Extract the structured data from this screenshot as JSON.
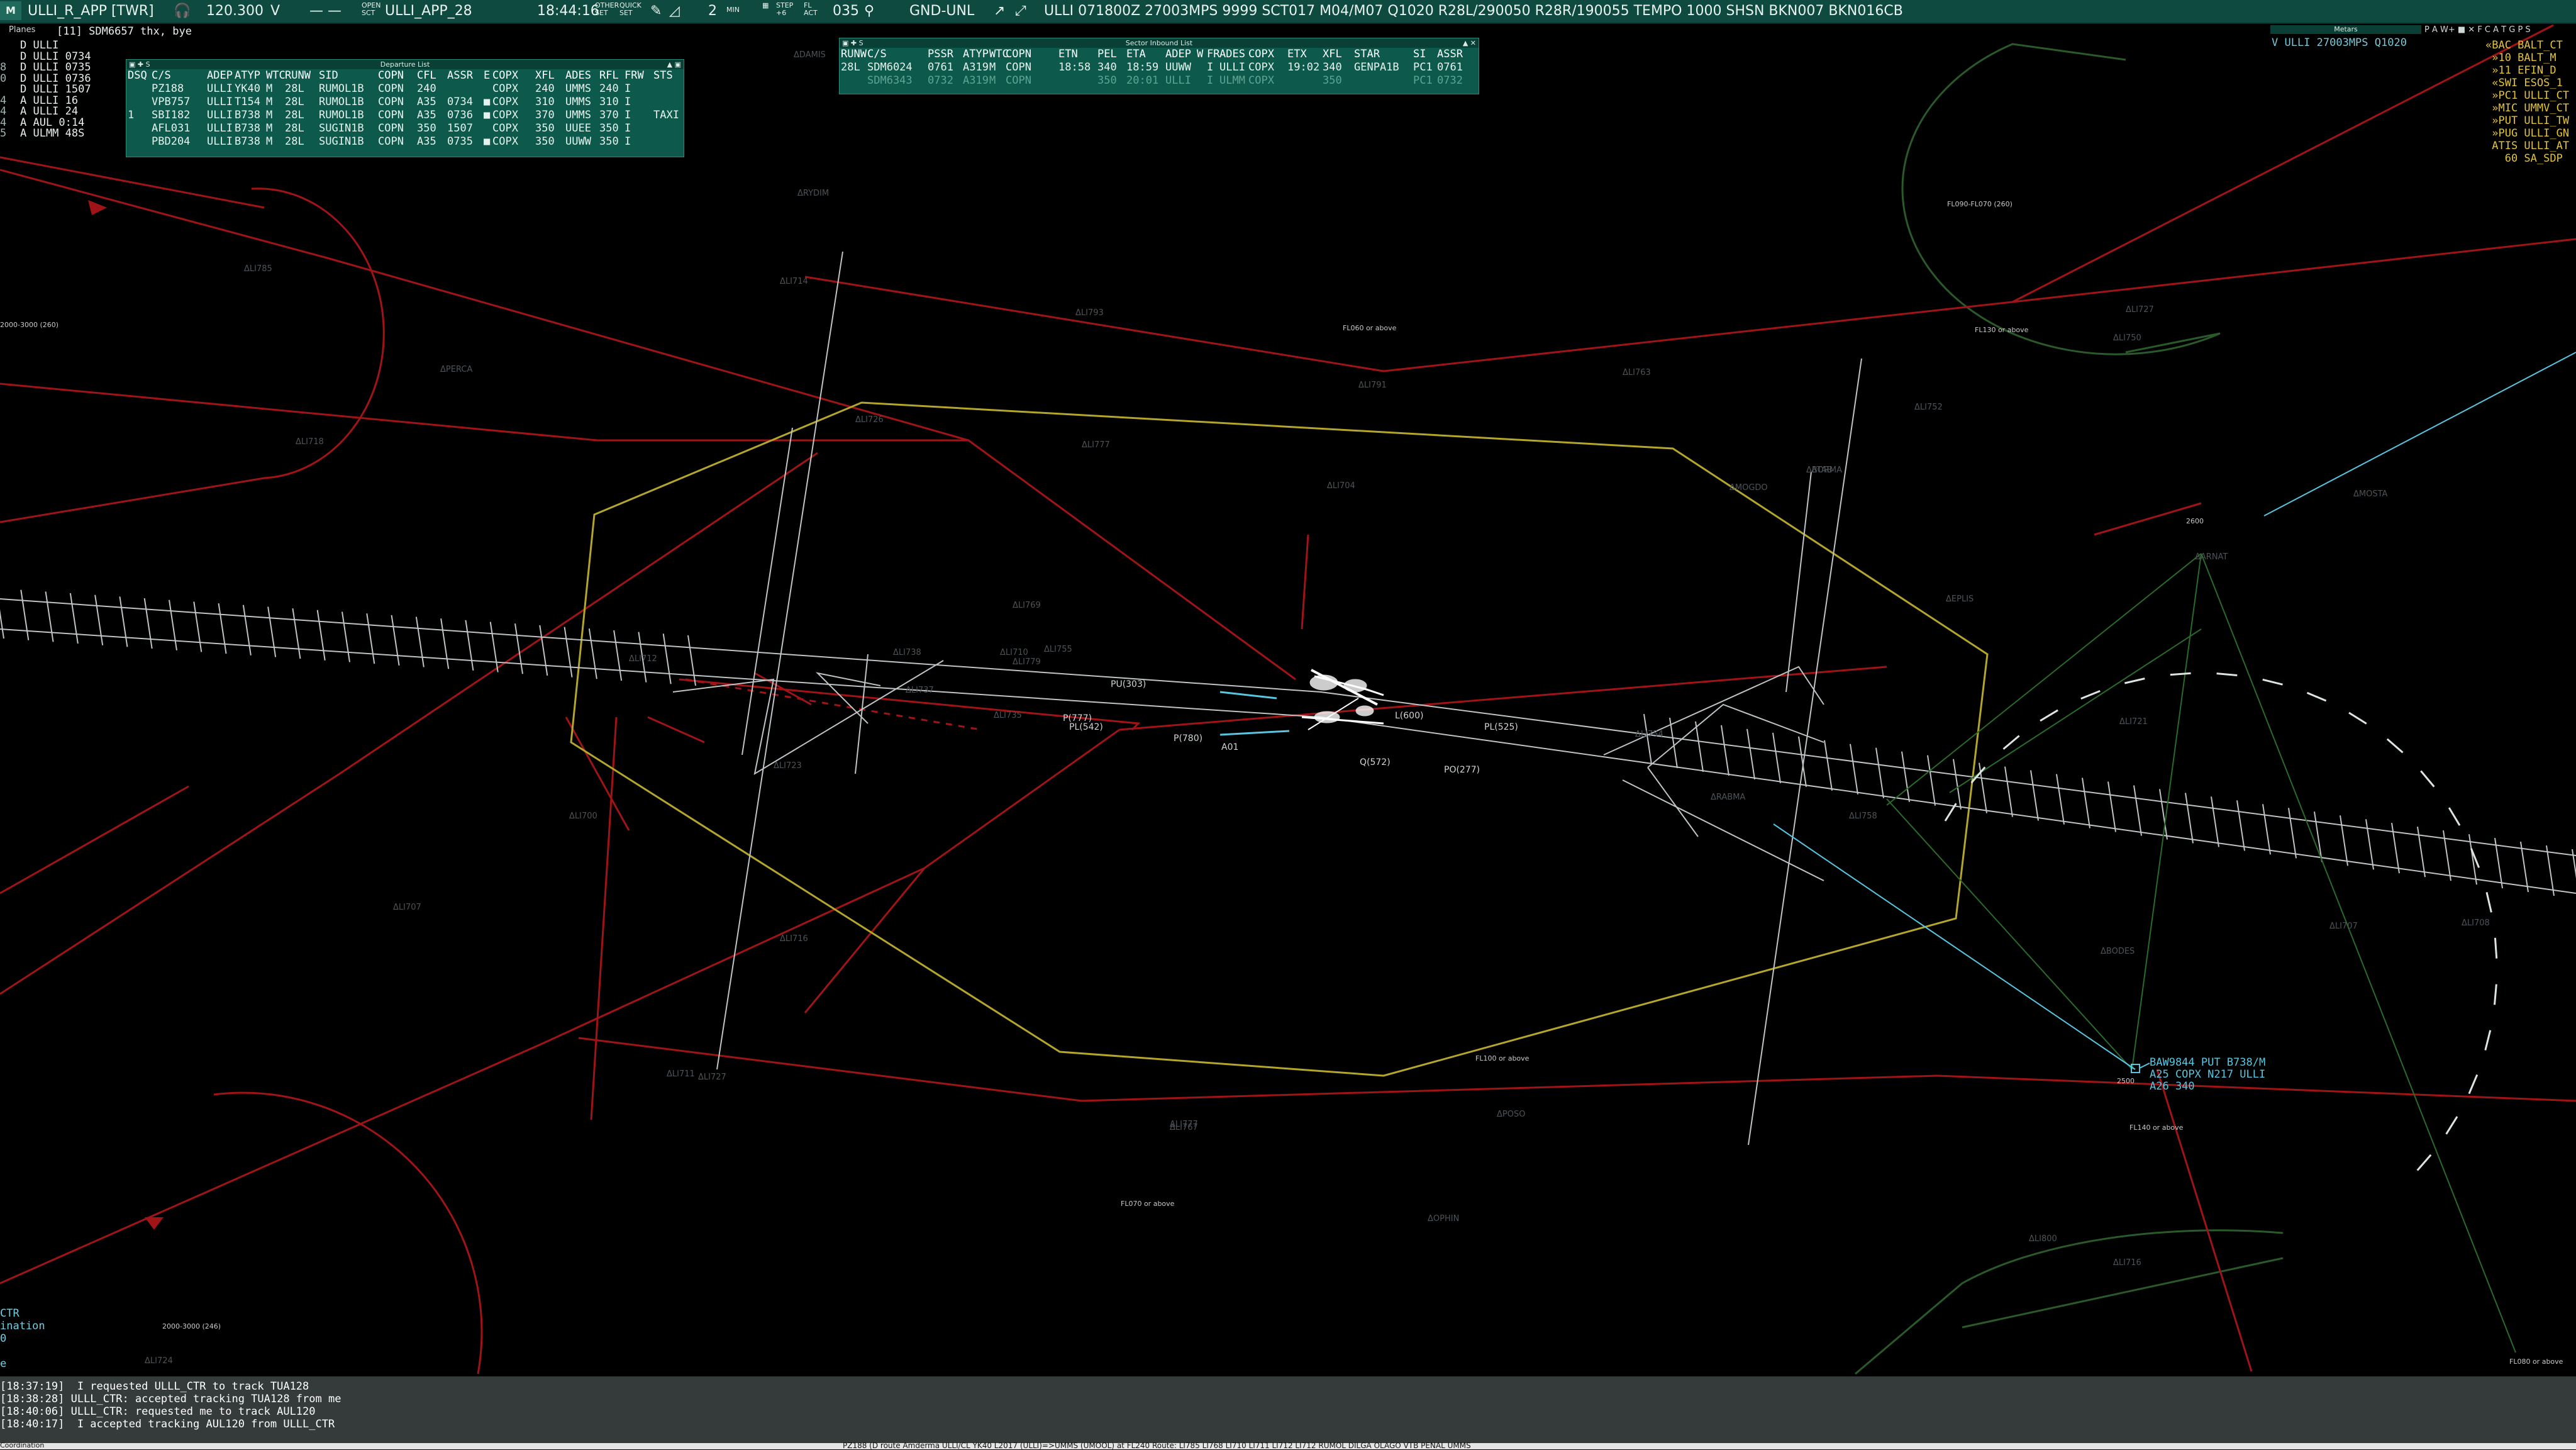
{
  "topbar": {
    "app_icon": "M",
    "position": "ULLI_R_APP [TWR]",
    "frequency": "120.300",
    "voice_flag": "V",
    "dash": "— —",
    "open_sct_top": "OPEN",
    "open_sct_bottom": "SCT",
    "callsign": "ULLI_APP_28",
    "time": "18:44:16",
    "other_set_top": "OTHER",
    "other_set_bottom": "SET",
    "quick_set_top": "QUICK",
    "quick_set_bottom": "SET",
    "count": "2",
    "min_label": "MIN",
    "step_top": "STEP",
    "step_bottom": "+6",
    "fl_top": "FL",
    "fl_bottom": "ACT",
    "heading": "035",
    "gnd_unl": "GND-UNL",
    "metar": "ULLI 071800Z 27003MPS 9999 SCT017 M04/M07 Q1020 R28L/290050 R28R/190055 TEMPO 1000 SHSN BKN007 BKN016CB"
  },
  "planes": {
    "tab": "Planes",
    "message": "[11] SDM6657 thx, bye",
    "list": "D ULLI\nD ULLI 0734\nD ULLI 0735\nD ULLI 0736\nD ULLI 1507\nA ULLI 16\nA ULLI 24\nA AUL 0:14\nA ULMM 48S",
    "left_markers": "\n\n8\n0\n\n4\n4\n4\n5"
  },
  "departure_list": {
    "title": "Departure List",
    "headers": [
      "DSQ",
      "C/S",
      "ADEP",
      "ATYP",
      "WTC",
      "RUNW",
      "SID",
      "COPN",
      "CFL",
      "ASSR",
      "E",
      "COPX",
      "XFL",
      "ADES",
      "RFL",
      "FRW",
      "STS"
    ],
    "rows": [
      {
        "dsq": "",
        "cs": "PZ188",
        "adep": "ULLI",
        "atyp": "YK40",
        "wtc": "M",
        "runw": "28L",
        "sid": "RUMOL1B",
        "copn": "COPN",
        "cfl": "240",
        "assr": "",
        "e": "",
        "copx": "COPX",
        "xfl": "240",
        "ades": "UMMS",
        "rfl": "240",
        "frw": "I",
        "sts": ""
      },
      {
        "dsq": "",
        "cs": "VPB757",
        "adep": "ULLI",
        "atyp": "T154",
        "wtc": "M",
        "runw": "28L",
        "sid": "RUMOL1B",
        "copn": "COPN",
        "cfl": "A35",
        "assr": "0734",
        "e": "■",
        "copx": "COPX",
        "xfl": "310",
        "ades": "UMMS",
        "rfl": "310",
        "frw": "I",
        "sts": ""
      },
      {
        "dsq": "1",
        "cs": "SBI182",
        "adep": "ULLI",
        "atyp": "B738",
        "wtc": "M",
        "runw": "28L",
        "sid": "RUMOL1B",
        "copn": "COPN",
        "cfl": "A35",
        "assr": "0736",
        "e": "■",
        "copx": "COPX",
        "xfl": "370",
        "ades": "UMMS",
        "rfl": "370",
        "frw": "I",
        "sts": "TAXI"
      },
      {
        "dsq": "",
        "cs": "AFL031",
        "adep": "ULLI",
        "atyp": "B738",
        "wtc": "M",
        "runw": "28L",
        "sid": "SUGIN1B",
        "copn": "COPN",
        "cfl": "350",
        "assr": "1507",
        "e": "",
        "copx": "COPX",
        "xfl": "350",
        "ades": "UUEE",
        "rfl": "350",
        "frw": "I",
        "sts": ""
      },
      {
        "dsq": "",
        "cs": "PBD204",
        "adep": "ULLI",
        "atyp": "B738",
        "wtc": "M",
        "runw": "28L",
        "sid": "SUGIN1B",
        "copn": "COPN",
        "cfl": "A35",
        "assr": "0735",
        "e": "■",
        "copx": "COPX",
        "xfl": "350",
        "ades": "UUWW",
        "rfl": "350",
        "frw": "I",
        "sts": ""
      }
    ]
  },
  "inbound_list": {
    "title": "Sector Inbound List",
    "headers": [
      "RUNW",
      "C/S",
      "PSSR",
      "ATYP",
      "WTC",
      "COPN",
      "ETN",
      "PEL",
      "ETA",
      "ADEP",
      "W",
      "FR",
      "ADES",
      "COPX",
      "ETX",
      "XFL",
      "STAR",
      "SI",
      "ASSR"
    ],
    "rows": [
      {
        "runw": "28L",
        "cs": "SDM6024",
        "pssr": "0761",
        "atyp": "A319",
        "wtc": "M",
        "copn": "COPN",
        "etn": "18:58",
        "pel": "340",
        "eta": "18:59",
        "adep": "UUWW",
        "w": "",
        "fr": "I",
        "ades": "ULLI",
        "copx": "COPX",
        "etx": "19:02",
        "xfl": "340",
        "star": "GENPA1B",
        "si": "PC1",
        "assr": "0761"
      },
      {
        "runw": "",
        "cs": "SDM6343",
        "pssr": "0732",
        "atyp": "A319",
        "wtc": "M",
        "copn": "COPN",
        "etn": "",
        "pel": "350",
        "eta": "20:01",
        "adep": "ULLI",
        "w": "",
        "fr": "I",
        "ades": "ULMM",
        "copx": "COPX",
        "etx": "",
        "xfl": "350",
        "star": "",
        "si": "PC1",
        "assr": "0732"
      }
    ]
  },
  "metar_window": {
    "title": "Metars",
    "line": "V ULLI 27003MPS Q1020",
    "icons": "P A W+ ■ ✕  F C A T G P S"
  },
  "atis_list": "«BAC BALT_CT\n »10 BALT_M\n »11 EFIN_D\n «SWI ESOS_1\n »PC1 ULLI_CT\n »MIC UMMV_CT\n »PUT ULLI_TW\n »PUG ULLI_GN\n ATIS ULLI_AT\n   60 SA_SDP",
  "aircraft": {
    "label": "BAW9844 PUT B738/M\nA25 COPX N217 ULLI\nA26 340",
    "squawk_tag": "2500"
  },
  "map_labels": {
    "fixes": [
      {
        "name": "ΔDAMIS"
      },
      {
        "name": "ΔRYDIM"
      },
      {
        "name": "ΔLI785"
      },
      {
        "name": "ΔLI793"
      },
      {
        "name": "ΔLI791"
      },
      {
        "name": "ΔLI714"
      },
      {
        "name": "ΔLI712"
      },
      {
        "name": "ΔLI718"
      },
      {
        "name": "ΔLI726"
      },
      {
        "name": "ΔPERCA"
      },
      {
        "name": "ΔLI724"
      },
      {
        "name": "ΔLI711"
      },
      {
        "name": "ΔLI777"
      },
      {
        "name": "ΔLI767"
      },
      {
        "name": "ΔLI763"
      },
      {
        "name": "ΔLI752"
      },
      {
        "name": "ΔLI704"
      },
      {
        "name": "ΔLI769"
      },
      {
        "name": "ΔLI755"
      },
      {
        "name": "ΔMOGDO"
      },
      {
        "name": "ΔEPLIS"
      },
      {
        "name": "ΔBORMA"
      },
      {
        "name": "ΔRABMA"
      },
      {
        "name": "ΔLI721"
      },
      {
        "name": "ΔLI750"
      },
      {
        "name": "ΔMOSTA"
      },
      {
        "name": "ΔARNAT"
      },
      {
        "name": "ΔLI707"
      },
      {
        "name": "ΔLI708"
      },
      {
        "name": "ΔLI716"
      },
      {
        "name": "ΔPOSO"
      },
      {
        "name": "ΔLI777"
      },
      {
        "name": "ΔOPHIN"
      },
      {
        "name": "ΔLI800"
      },
      {
        "name": "ΔBODES"
      },
      {
        "name": "ΔLI735"
      },
      {
        "name": "ΔLI738"
      },
      {
        "name": "ΔLI737"
      },
      {
        "name": "ΔLI779"
      },
      {
        "name": "ΔLI723"
      },
      {
        "name": "ΔLI716"
      },
      {
        "name": "ΔLI707"
      },
      {
        "name": "ΔLI700"
      },
      {
        "name": "ΔLI727"
      },
      {
        "name": "ΔTAB"
      },
      {
        "name": "ΔLI727"
      },
      {
        "name": "ΔLI754"
      },
      {
        "name": "ΔLI710"
      },
      {
        "name": "ΔLI758"
      }
    ],
    "areas": [
      {
        "text": "FL060 or above"
      },
      {
        "text": "FL090-FL070 (260)"
      },
      {
        "text": "FL130 or above"
      },
      {
        "text": "2000-3000 (260)"
      },
      {
        "text": "2600"
      },
      {
        "text": "FL100 or above"
      },
      {
        "text": "FL070 or above"
      },
      {
        "text": "2000-3000 (246)"
      },
      {
        "text": "FL140 or above"
      },
      {
        "text": "FL080 or above"
      }
    ],
    "runway_fixes": [
      {
        "text": "PU(303)"
      },
      {
        "text": "PL(525)"
      },
      {
        "text": "P(777)"
      },
      {
        "text": "L(600)"
      },
      {
        "text": "P(780)"
      },
      {
        "text": "PL(542)"
      },
      {
        "text": "Q(572)"
      },
      {
        "text": "A01"
      },
      {
        "text": "PO(277)"
      }
    ]
  },
  "messages": "[18:37:19]  I requested ULLL_CTR to track TUA128\n[18:38:28] ULLL_CTR: accepted tracking TUA128 from me\n[18:40:06] ULLL_CTR: requested me to track AUL120\n[18:40:17]  I accepted tracking AUL120 from ULLL_CTR",
  "left_bottom": "CTR\nination\n0\n\ne",
  "statusbar": {
    "coord_tab": "Coordination",
    "text": "PZ188 (D route Amderma ULLI/CL YK40 L2017 (ULLI)=>UMMS (UMOOL) at FL240 Route: LI785 LI768 LI710 LI711 LI712 LI712 RUMOL DILGA OLAGO VTB PENAL UMMS"
  },
  "colors": {
    "topbar": "#0e4a40",
    "list_bg": "#0d5a4c",
    "sector_yellow": "#b4a62c",
    "airway_red": "#a01418",
    "approach_grey": "#bfc4c6",
    "arc_green": "#2a5a2a",
    "cyan_track": "#58c6e0",
    "atis_amber": "#e3c33a"
  }
}
